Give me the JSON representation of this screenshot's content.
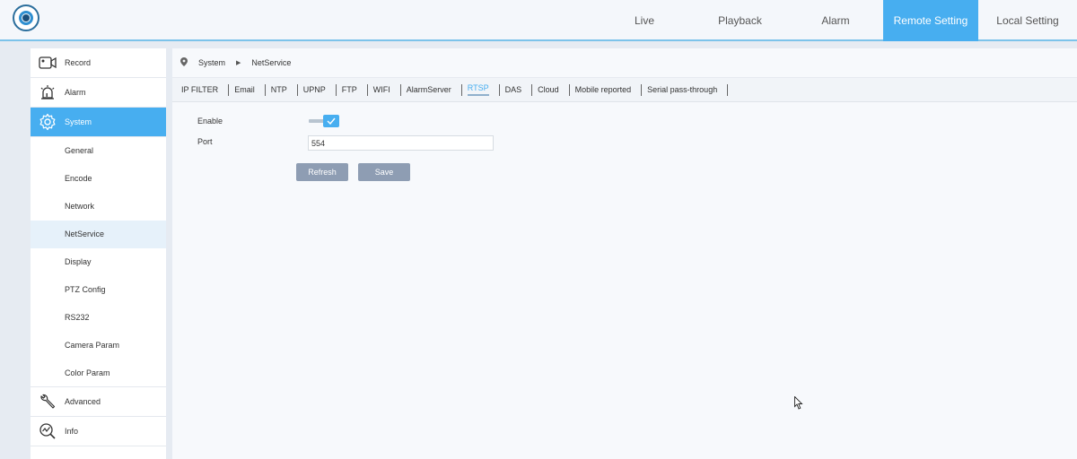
{
  "app": {
    "accent_color": "#47aef0",
    "logo_icon": "camera-eye-logo"
  },
  "nav": {
    "items": [
      {
        "label": "Live",
        "active": false
      },
      {
        "label": "Playback",
        "active": false
      },
      {
        "label": "Alarm",
        "active": false
      },
      {
        "label": "Remote Setting",
        "active": true
      },
      {
        "label": "Local Setting",
        "active": false
      }
    ]
  },
  "sidebar": {
    "record": {
      "label": "Record",
      "icon": "camera-icon"
    },
    "alarm": {
      "label": "Alarm",
      "icon": "siren-icon"
    },
    "system": {
      "label": "System",
      "icon": "gear-icon",
      "active": true
    },
    "sub_items": [
      {
        "label": "General"
      },
      {
        "label": "Encode"
      },
      {
        "label": "Network"
      },
      {
        "label": "NetService",
        "active": true
      },
      {
        "label": "Display"
      },
      {
        "label": "PTZ Config"
      },
      {
        "label": "RS232"
      },
      {
        "label": "Camera Param"
      },
      {
        "label": "Color Param"
      }
    ],
    "advanced": {
      "label": "Advanced",
      "icon": "wrench-icon"
    },
    "info": {
      "label": "Info",
      "icon": "info-search-icon"
    }
  },
  "breadcrumb": {
    "root": "System",
    "current": "NetService"
  },
  "tabs": [
    {
      "label": "IP FILTER"
    },
    {
      "label": "Email"
    },
    {
      "label": "NTP"
    },
    {
      "label": "UPNP"
    },
    {
      "label": "FTP"
    },
    {
      "label": "WIFI"
    },
    {
      "label": "AlarmServer"
    },
    {
      "label": "RTSP",
      "active": true
    },
    {
      "label": "DAS"
    },
    {
      "label": "Cloud"
    },
    {
      "label": "Mobile reported"
    },
    {
      "label": "Serial pass-through"
    }
  ],
  "form": {
    "enable_label": "Enable",
    "enable_checked": true,
    "port_label": "Port",
    "port_value": "554",
    "refresh_label": "Refresh",
    "save_label": "Save"
  }
}
